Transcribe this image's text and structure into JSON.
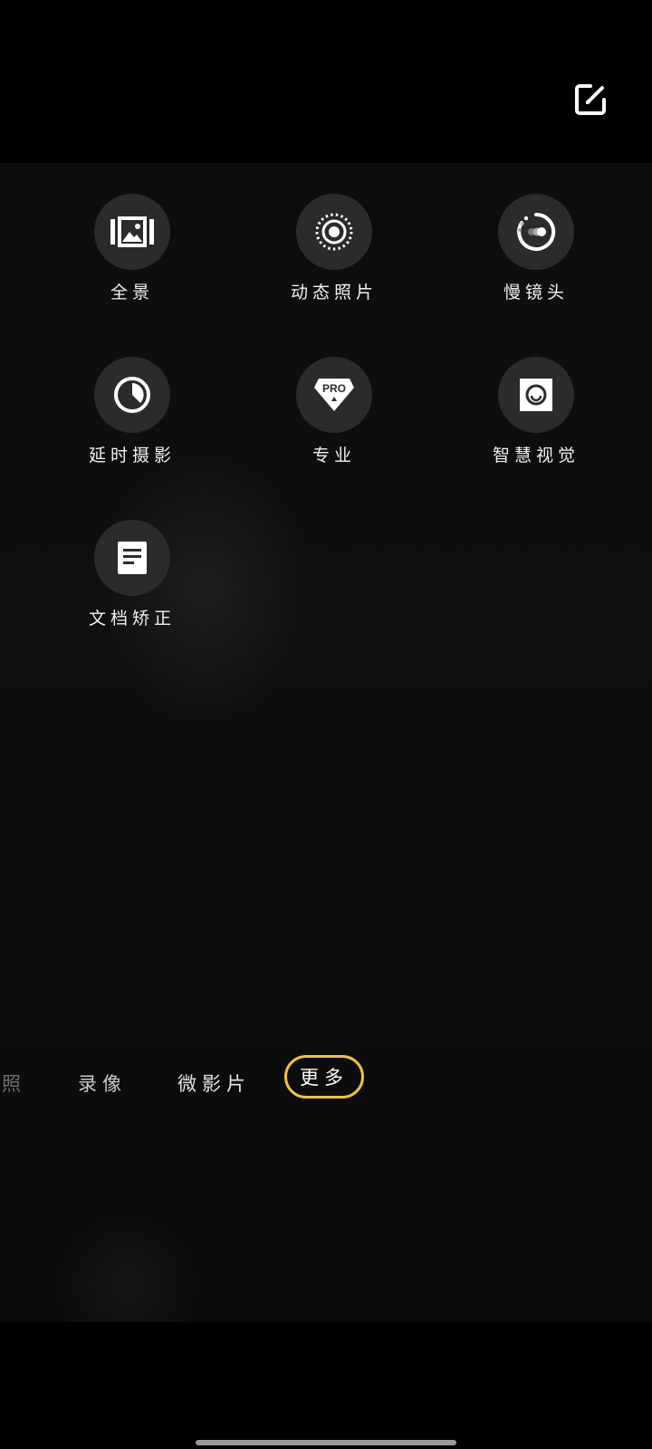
{
  "header": {
    "edit_icon": "edit-square-icon"
  },
  "modes": [
    {
      "label": "全景",
      "icon": "panorama-icon"
    },
    {
      "label": "动态照片",
      "icon": "live-photo-icon"
    },
    {
      "label": "慢镜头",
      "icon": "slow-motion-icon"
    },
    {
      "label": "延时摄影",
      "icon": "timelapse-icon"
    },
    {
      "label": "专业",
      "icon": "pro-icon"
    },
    {
      "label": "智慧视觉",
      "icon": "smart-vision-icon"
    },
    {
      "label": "文档矫正",
      "icon": "document-icon"
    }
  ],
  "pro_badge": "PRO",
  "mode_strip": {
    "items": [
      "照",
      "录像",
      "微影片"
    ],
    "active": "更多"
  },
  "colors": {
    "accent": "#f0c23b",
    "circle_bg": "#2b2b2b"
  }
}
